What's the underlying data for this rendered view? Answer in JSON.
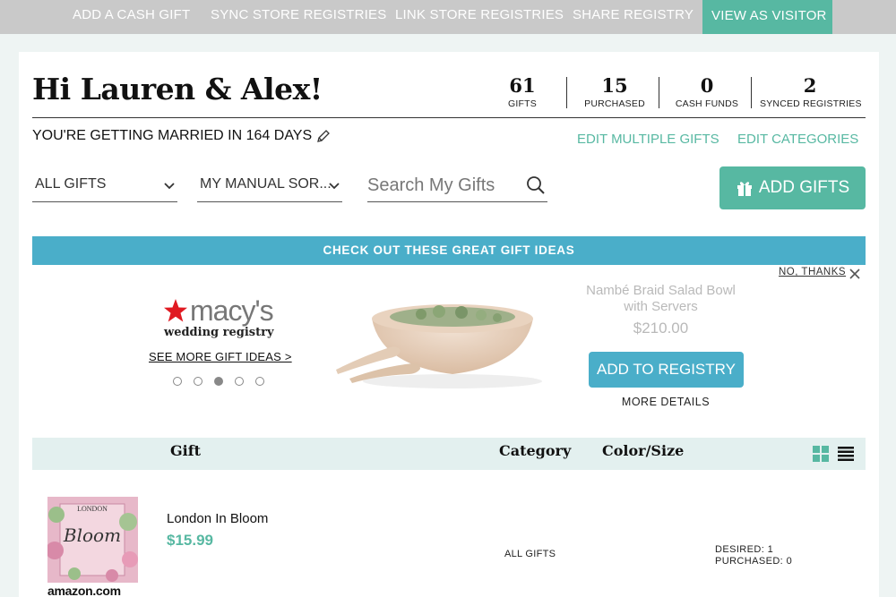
{
  "nav": {
    "items": [
      {
        "label": "ADD A CASH GIFT"
      },
      {
        "label": "SYNC STORE REGISTRIES"
      },
      {
        "label": "LINK STORE REGISTRIES"
      },
      {
        "label": "SHARE REGISTRY"
      },
      {
        "label": "VIEW AS VISITOR"
      }
    ]
  },
  "header": {
    "greeting": "Hi Lauren & Alex!",
    "countdown": "YOU'RE GETTING MARRIED IN 164 DAYS",
    "stats": [
      {
        "value": "61",
        "label": "GIFTS"
      },
      {
        "value": "15",
        "label": "PURCHASED"
      },
      {
        "value": "0",
        "label": "CASH FUNDS"
      },
      {
        "value": "2",
        "label": "SYNCED REGISTRIES"
      }
    ],
    "edit_multiple": "EDIT MULTIPLE GIFTS",
    "edit_categories": "EDIT CATEGORIES"
  },
  "filters": {
    "category_selected": "ALL GIFTS",
    "sort_selected": "MY MANUAL SOR...",
    "search_placeholder": "Search My Gifts",
    "add_gifts_label": "ADD GIFTS"
  },
  "promo": {
    "banner": "CHECK OUT THESE GREAT GIFT IDEAS",
    "no_thanks": "NO, THANKS",
    "brand_name": "macy's",
    "brand_sub": "wedding registry",
    "see_more": "SEE MORE GIFT IDEAS >",
    "carousel_active_index": 2,
    "carousel_count": 5,
    "product_name": "Nambé Braid Salad Bowl with Servers",
    "product_price": "$210.00",
    "add_to_registry": "ADD TO REGISTRY",
    "more_details": "MORE DETAILS"
  },
  "table": {
    "headers": [
      "Gift",
      "Category",
      "Color/Size"
    ],
    "rows": [
      {
        "name": "London In Bloom",
        "price": "$15.99",
        "category": "ALL GIFTS",
        "desired": "DESIRED: 1",
        "purchased": "PURCHASED: 0",
        "store": "amazon.com",
        "cover_title_top": "LONDON",
        "cover_title_script": "Bloom"
      }
    ]
  },
  "colors": {
    "teal": "#57b8a2",
    "blue": "#4aaec9",
    "nav_bg": "#c9c9c9",
    "page_bg": "#eef4f3"
  }
}
